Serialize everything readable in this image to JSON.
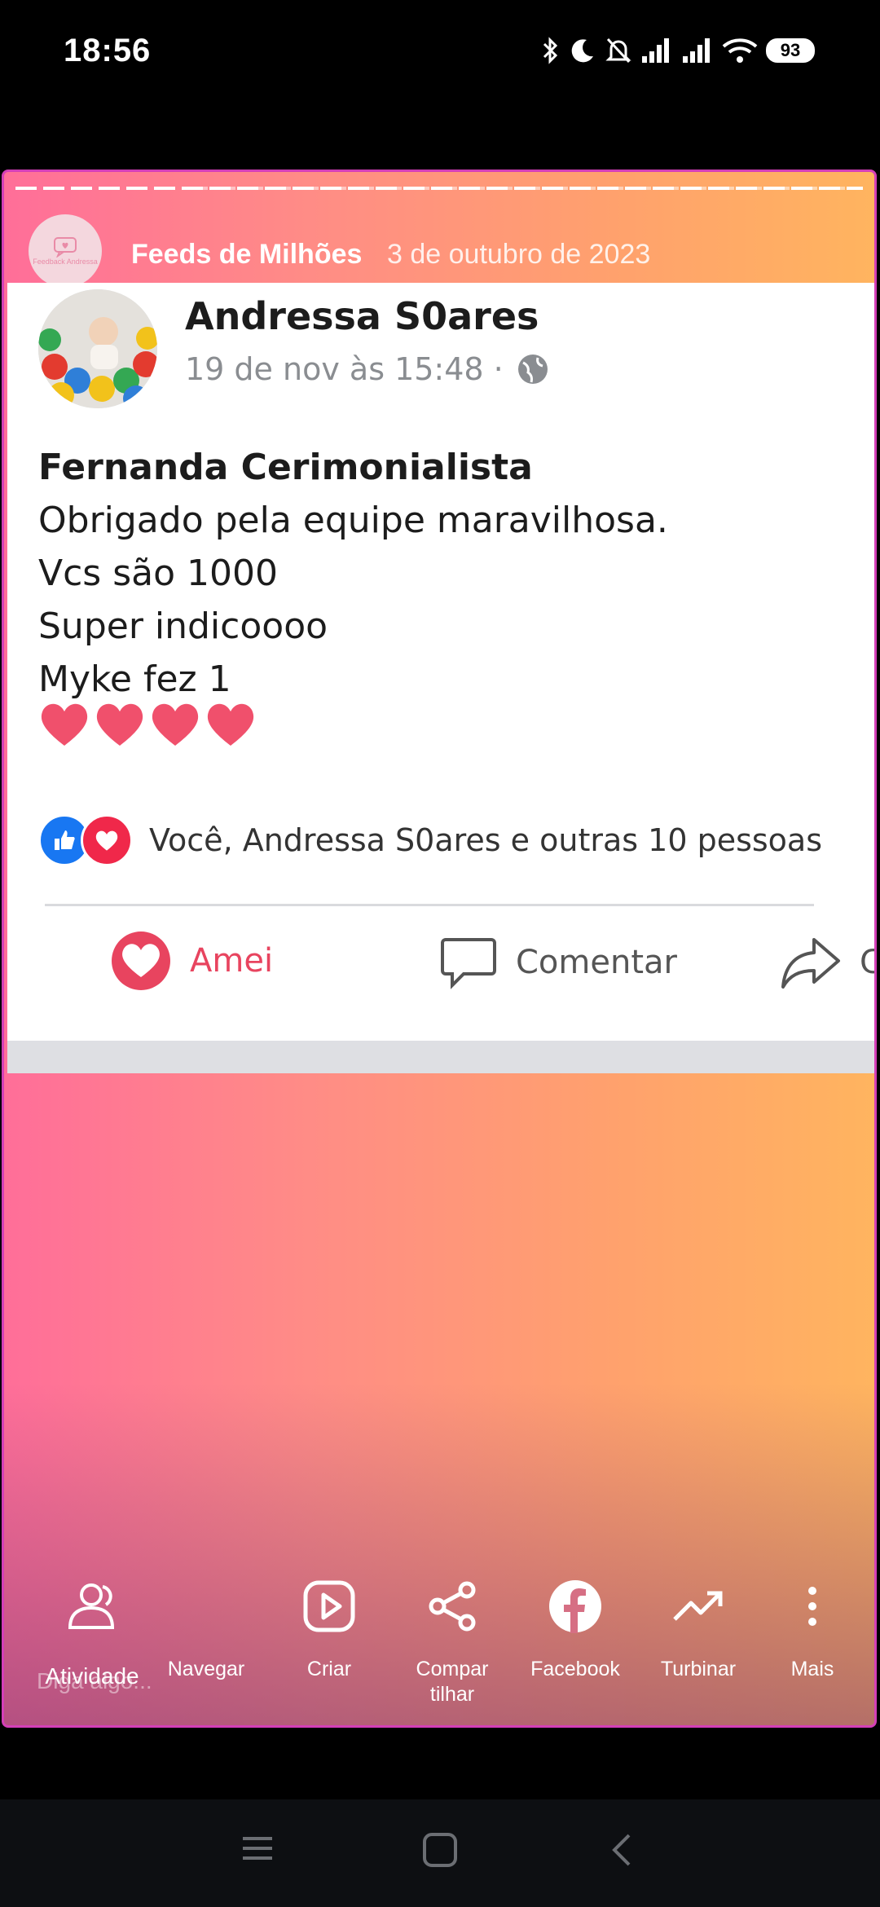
{
  "status_bar": {
    "time": "18:56",
    "battery": "93",
    "icons": [
      "bluetooth-icon",
      "moon-icon",
      "bell-off-icon",
      "signal-icon",
      "signal-icon",
      "wifi-icon",
      "battery-icon"
    ]
  },
  "story": {
    "page_name": "Feeds de Milhões",
    "date": "3 de outubro de 2023",
    "avatar_text": "Feedback Andressa"
  },
  "post": {
    "author": "Andressa S0ares",
    "timestamp": "19 de nov às 15:48 ·",
    "lines": [
      "Fernanda Cerimonialista",
      "Obrigado pela equipe maravilhosa.",
      "Vcs são 1000",
      "Super indicoooo",
      "Myke fez 1"
    ],
    "hearts": 4,
    "reactions_text": "Você, Andressa S0ares e outras 10 pessoas",
    "actions": {
      "love": "Amei",
      "comment": "Comentar",
      "share": "C"
    }
  },
  "toolbar": {
    "activity": "Atividade",
    "browse": "Navegar",
    "create": "Criar",
    "share": "Compar tilhar",
    "facebook": "Facebook",
    "boost": "Turbinar",
    "more": "Mais"
  },
  "reply_placeholder": "Diga algo...",
  "colors": {
    "frame": "#d43fb8",
    "gradient_start": "#ff6e99",
    "gradient_end": "#ffb45f",
    "love": "#e8445f",
    "like": "#1877f2"
  }
}
